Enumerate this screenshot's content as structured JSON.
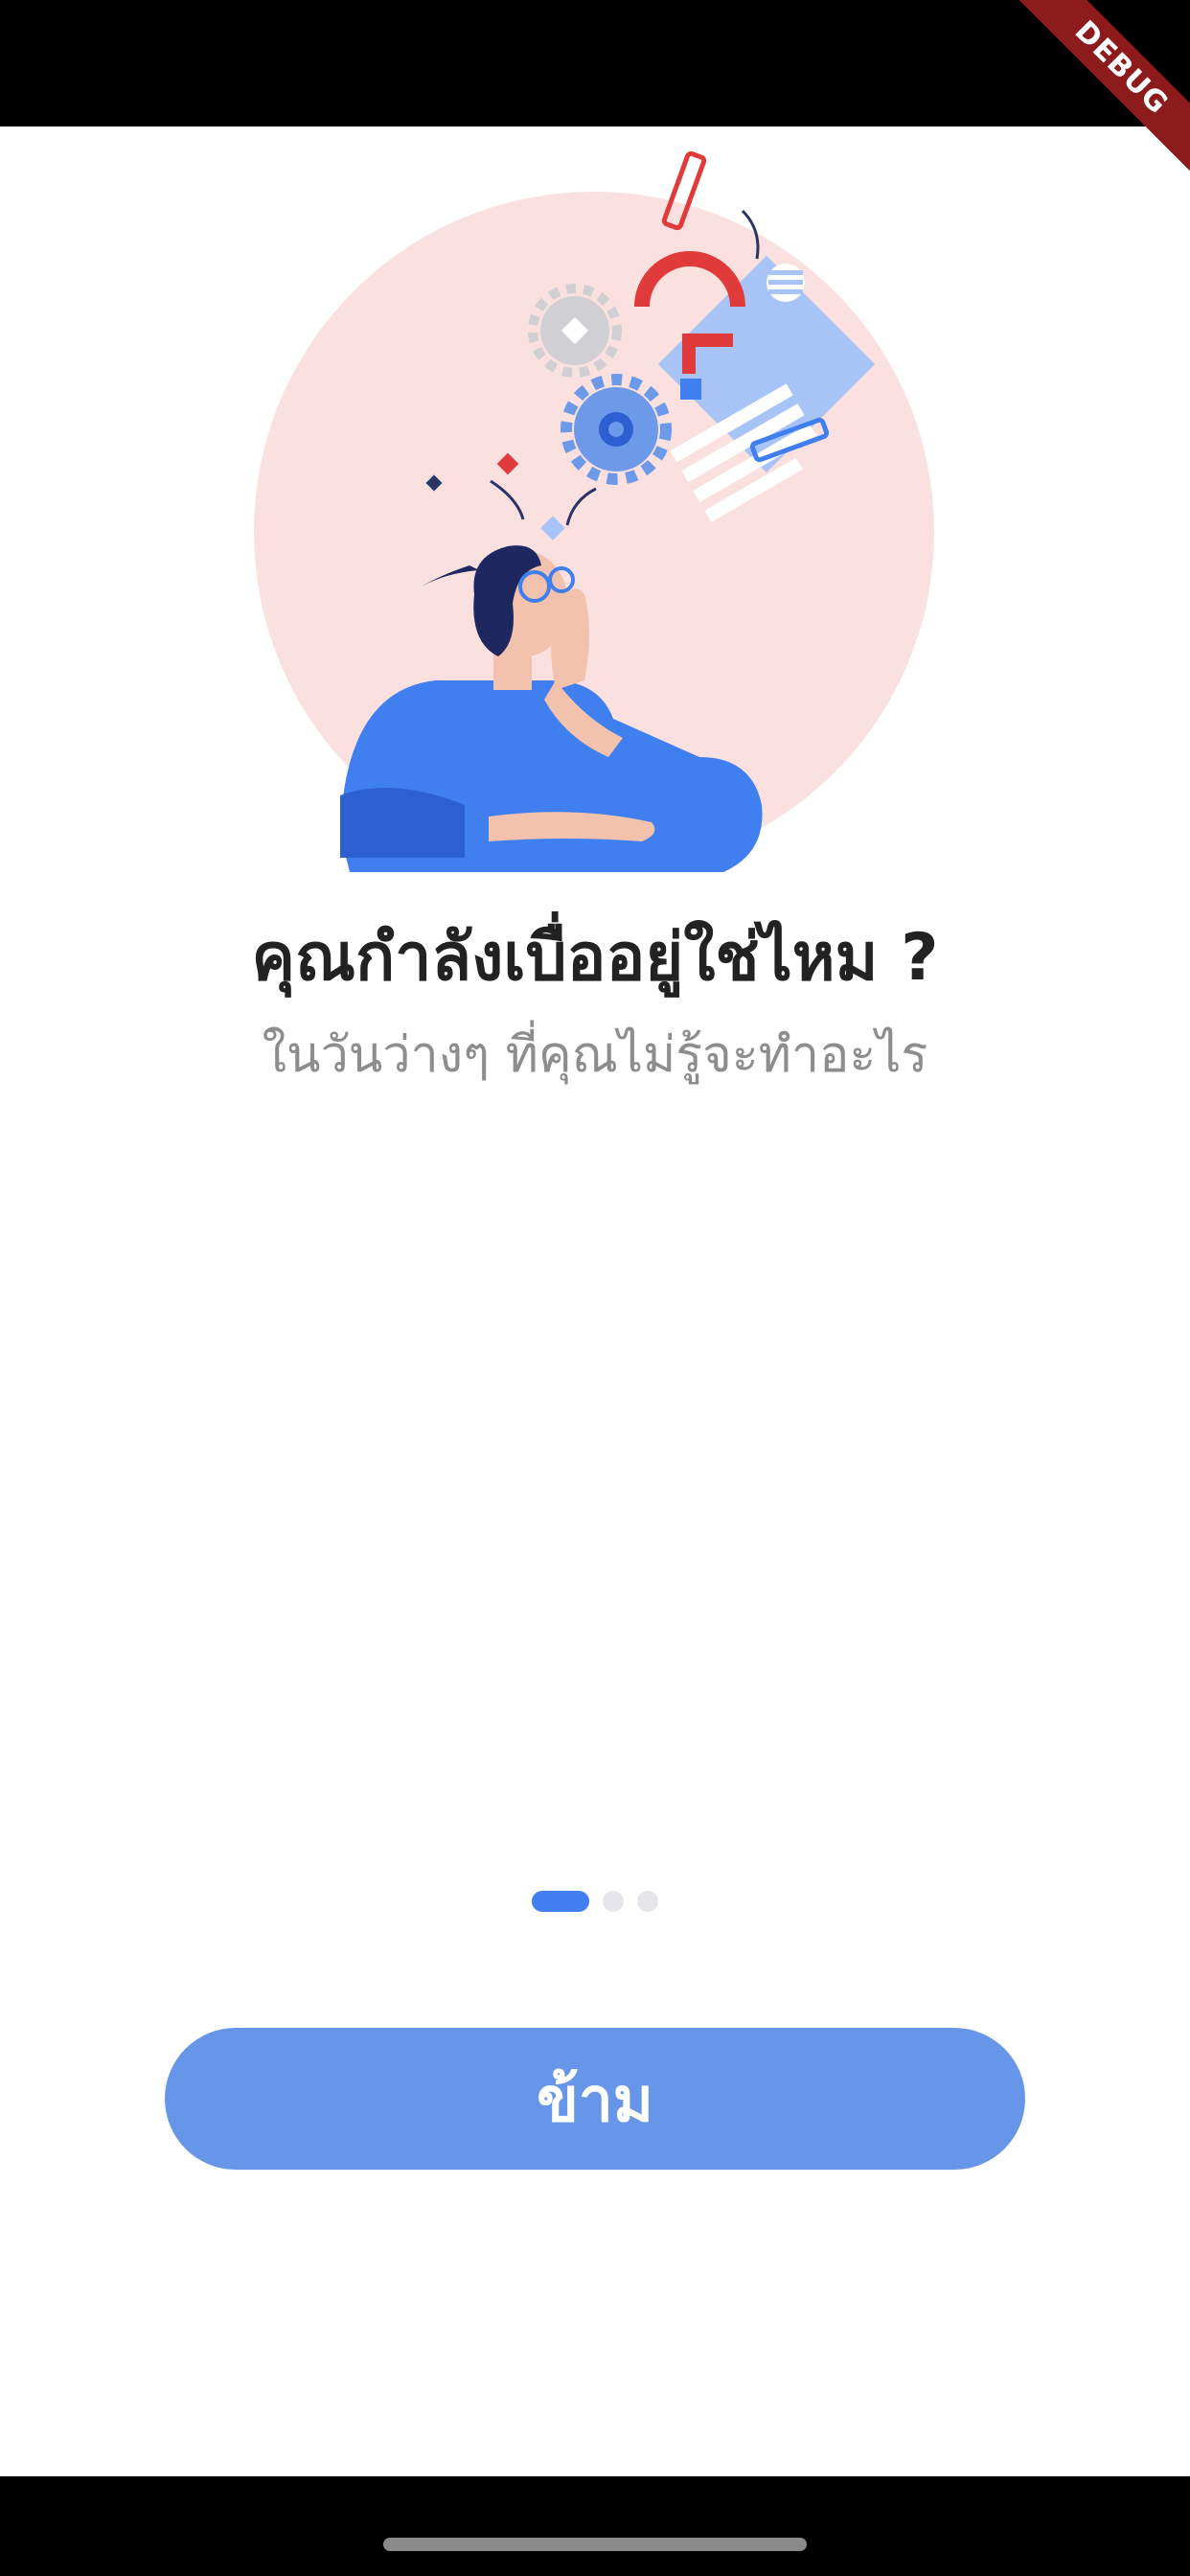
{
  "debug_banner": {
    "label": "DEBUG"
  },
  "onboarding": {
    "title": "คุณกำลังเบื่ออยู่ใช่ไหม ?",
    "subtitle": "ในวันว่างๆ ที่คุณไม่รู้จะทำอะไร",
    "page_indicator": {
      "current_page": 1,
      "total_pages": 3
    },
    "skip_label": "ข้าม"
  },
  "colors": {
    "accent": "#3f7ff0",
    "button": "#6795e8",
    "title_text": "#222222",
    "subtitle_text": "#8d8d8d",
    "illustration_circle": "#fae0df"
  }
}
